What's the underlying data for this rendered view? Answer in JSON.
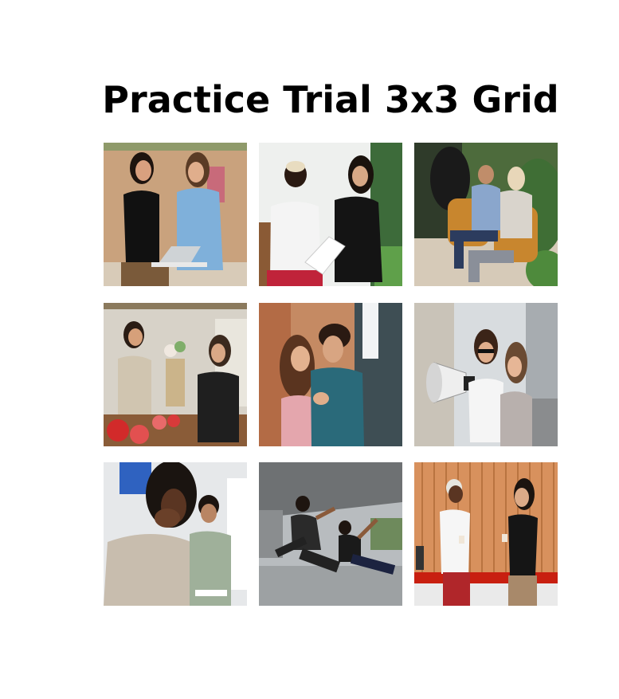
{
  "title": "Practice Trial 3x3 Grid",
  "grid": {
    "images": [
      {
        "name": "image-two-women-laptop-meeting"
      },
      {
        "name": "image-two-women-talking-paper"
      },
      {
        "name": "image-man-woman-armchairs-plants"
      },
      {
        "name": "image-florist-customer-shop"
      },
      {
        "name": "image-couple-embracing-street"
      },
      {
        "name": "image-women-megaphone-street"
      },
      {
        "name": "image-distressed-man-counselor"
      },
      {
        "name": "image-two-men-breakdancing"
      },
      {
        "name": "image-two-women-coffee-wood-wall"
      }
    ]
  }
}
